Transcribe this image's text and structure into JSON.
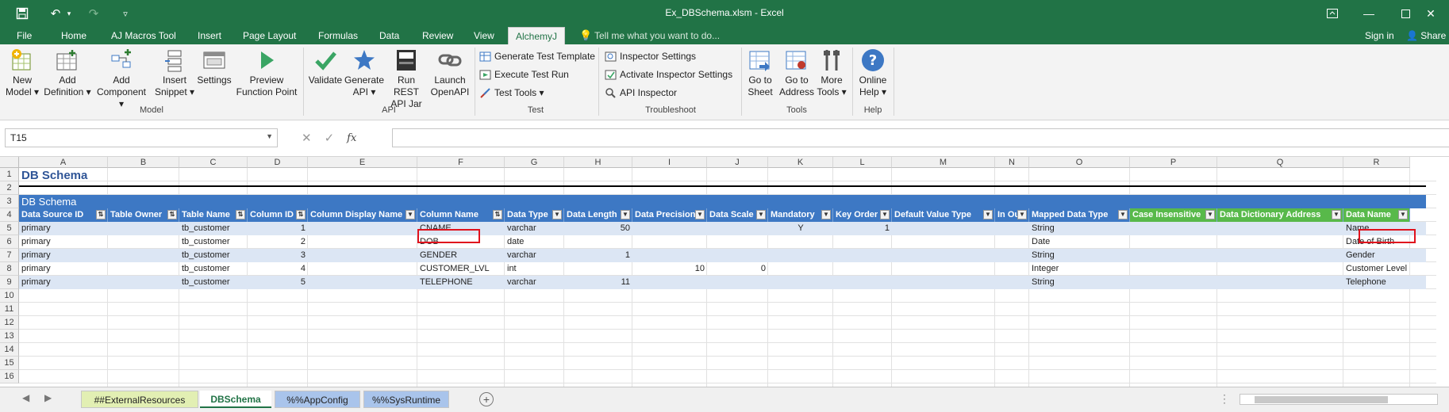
{
  "window": {
    "title": "Ex_DBSchema.xlsm - Excel"
  },
  "ribbon_tabs": [
    {
      "label": "File"
    },
    {
      "label": "Home"
    },
    {
      "label": "AJ Macros Tool"
    },
    {
      "label": "Insert"
    },
    {
      "label": "Page Layout"
    },
    {
      "label": "Formulas"
    },
    {
      "label": "Data"
    },
    {
      "label": "Review"
    },
    {
      "label": "View"
    },
    {
      "label": "AlchemyJ"
    }
  ],
  "tell_me": "Tell me what you want to do...",
  "sign_in": "Sign in",
  "share": "Share",
  "groups": {
    "model": "Model",
    "api": "API",
    "test": "Test",
    "troubleshoot": "Troubleshoot",
    "tools": "Tools",
    "help": "Help"
  },
  "buttons": {
    "new_model": [
      "New",
      "Model ▾"
    ],
    "add_definition": [
      "Add",
      "Definition ▾"
    ],
    "add_component": [
      "Add",
      "Component ▾"
    ],
    "insert_snippet": [
      "Insert",
      "Snippet ▾"
    ],
    "settings": [
      "Settings",
      ""
    ],
    "preview": [
      "Preview",
      "Function Point"
    ],
    "validate": [
      "Validate",
      ""
    ],
    "generate_api": [
      "Generate",
      "API ▾"
    ],
    "run_rest": [
      "Run REST",
      "API Jar"
    ],
    "launch_openapi": [
      "Launch",
      "OpenAPI"
    ],
    "generate_test": "Generate Test Template",
    "execute_test": "Execute Test Run",
    "test_tools": "Test Tools ▾",
    "inspector_settings": "Inspector Settings",
    "activate_inspector": "Activate Inspector Settings",
    "api_inspector": "API Inspector",
    "go_to_sheet": [
      "Go to",
      "Sheet"
    ],
    "go_to_address": [
      "Go to",
      "Address"
    ],
    "more_tools": [
      "More",
      "Tools ▾"
    ],
    "online_help": [
      "Online",
      "Help ▾"
    ]
  },
  "name_box": "T15",
  "columns": [
    "A",
    "B",
    "C",
    "D",
    "E",
    "F",
    "G",
    "H",
    "I",
    "J",
    "K",
    "L",
    "M",
    "N",
    "O",
    "P",
    "Q",
    "R"
  ],
  "rows": [
    "1",
    "2",
    "3",
    "4",
    "5",
    "6",
    "7",
    "8",
    "9",
    "10",
    "11",
    "12",
    "13",
    "14",
    "15",
    "16"
  ],
  "sheet_title": "DB Schema",
  "table_band": "DB Schema",
  "table_headers": [
    "Data Source ID",
    "Table Owner",
    "Table Name",
    "Column ID",
    "Column Display Name",
    "Column Name",
    "Data Type",
    "Data Length",
    "Data Precision",
    "Data Scale",
    "Mandatory",
    "Key Order",
    "Default Value Type",
    "In Out",
    "Mapped Data Type",
    "Case Insensitive",
    "Data Dictionary Address",
    "Data Name"
  ],
  "table_rows": [
    {
      "ds": "primary",
      "tbl": "tb_customer",
      "cid": "1",
      "cname": "CNAME",
      "dtype": "varchar",
      "dlen": "50",
      "prec": "",
      "scale": "",
      "mand": "Y",
      "key": "1",
      "mapped": "String",
      "dname": "Name"
    },
    {
      "ds": "primary",
      "tbl": "tb_customer",
      "cid": "2",
      "cname": "DOB",
      "dtype": "date",
      "dlen": "",
      "prec": "",
      "scale": "",
      "mand": "",
      "key": "",
      "mapped": "Date",
      "dname": "Date of Birth"
    },
    {
      "ds": "primary",
      "tbl": "tb_customer",
      "cid": "3",
      "cname": "GENDER",
      "dtype": "varchar",
      "dlen": "1",
      "prec": "",
      "scale": "",
      "mand": "",
      "key": "",
      "mapped": "String",
      "dname": "Gender"
    },
    {
      "ds": "primary",
      "tbl": "tb_customer",
      "cid": "4",
      "cname": "CUSTOMER_LVL",
      "dtype": "int",
      "dlen": "",
      "prec": "10",
      "scale": "0",
      "mand": "",
      "key": "",
      "mapped": "Integer",
      "dname": "Customer Level"
    },
    {
      "ds": "primary",
      "tbl": "tb_customer",
      "cid": "5",
      "cname": "TELEPHONE",
      "dtype": "varchar",
      "dlen": "11",
      "prec": "",
      "scale": "",
      "mand": "",
      "key": "",
      "mapped": "String",
      "dname": "Telephone"
    }
  ],
  "sheet_tabs": [
    {
      "label": "##ExternalResources",
      "color": "#e2efb3"
    },
    {
      "label": "DBSchema",
      "color": "#ffffff"
    },
    {
      "label": "%%AppConfig",
      "color": "#a9c4eb"
    },
    {
      "label": "%%SysRuntime",
      "color": "#a9c4eb"
    }
  ],
  "colors": {
    "excel_green": "#217346",
    "table_blue": "#3d78c4",
    "green_header": "#58b94a",
    "highlight": "#e0121d"
  }
}
